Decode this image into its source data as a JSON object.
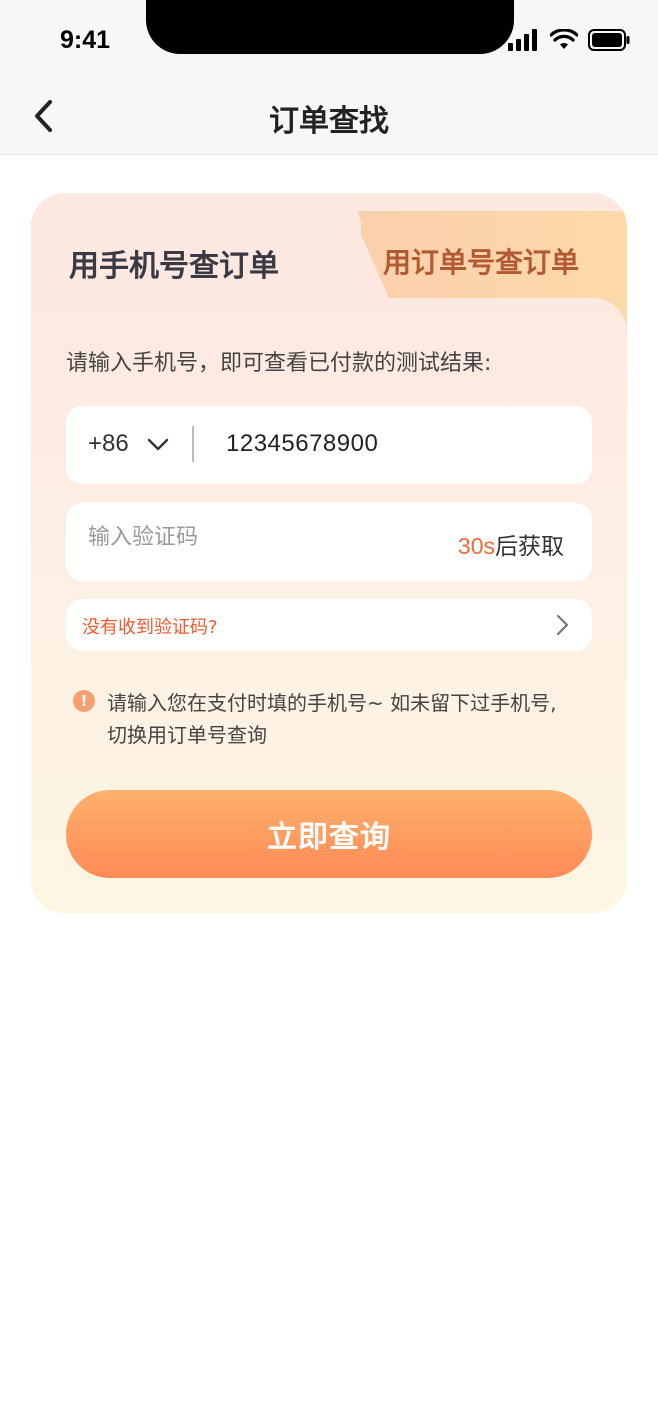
{
  "status_bar": {
    "time": "9:41"
  },
  "nav": {
    "title": "订单查找"
  },
  "tabs": [
    {
      "label": "用手机号查订单",
      "active": true
    },
    {
      "label": "用订单号查订单",
      "active": false
    }
  ],
  "form": {
    "hint": "请输入手机号，即可查看已付款的测试结果:",
    "country_code": "+86",
    "phone": "12345678900",
    "code_placeholder": "输入验证码",
    "countdown_number": "30s",
    "countdown_suffix": "后获取",
    "no_code_link": "没有收到验证码?",
    "notice_icon": "!",
    "notice_line1": "请输入您在支付时填的手机号~  如未留下过手机号,",
    "notice_line2": "切换用订单号查询",
    "submit_label": "立即查询"
  },
  "colors": {
    "accent": "#f06a35",
    "button_start": "#ffb16d",
    "button_end": "#ff8a55",
    "tab_inactive_text": "#b45a32"
  },
  "icons": {
    "back": "chevron-left-icon",
    "country_dropdown": "chevron-down-icon",
    "link_arrow": "chevron-right-icon",
    "notice": "exclamation-icon"
  }
}
